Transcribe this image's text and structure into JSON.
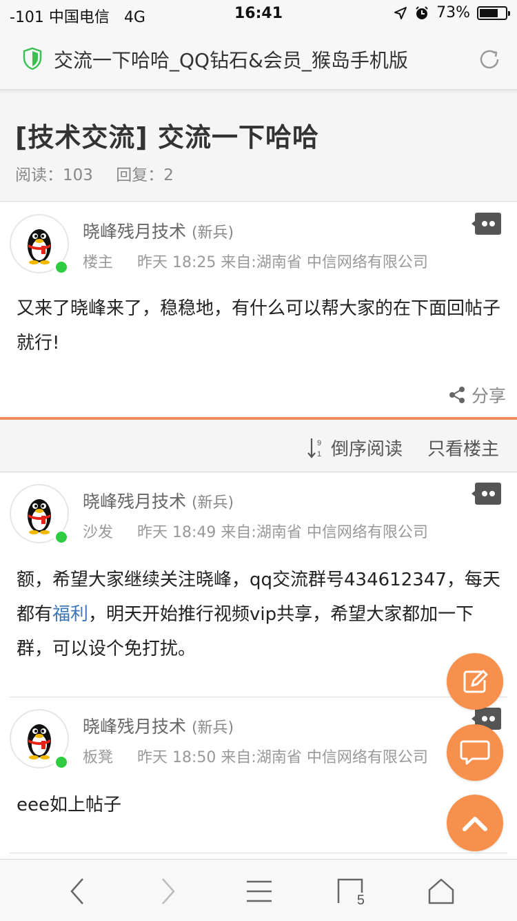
{
  "status_bar": {
    "carrier": "-101 中国电信",
    "network": "4G",
    "time": "16:41",
    "battery_text": "73%",
    "battery_level": 0.73
  },
  "browser": {
    "page_title": "交流一下哈哈_QQ钻石&会员_猴岛手机版",
    "tab_count": "5"
  },
  "thread": {
    "title": "[技术交流] 交流一下哈哈",
    "reads_label": "阅读：103",
    "replies_label": "回复：2"
  },
  "posts": [
    {
      "author": "晓峰残月技术",
      "rank": "(新兵)",
      "floor": "楼主",
      "time": "昨天 18:25",
      "location": "来自:湖南省 中信网络有限公司",
      "content": "又来了晓峰来了，稳稳地，有什么可以帮大家的在下面回帖子就行!"
    },
    {
      "author": "晓峰残月技术",
      "rank": "(新兵)",
      "floor": "沙发",
      "time": "昨天 18:49",
      "location": "来自:湖南省 中信网络有限公司",
      "content_before_link": "额，希望大家继续关注晓峰，qq交流群号434612347，每天都有",
      "link_text": "福利",
      "content_after_link": "，明天开始推行视频vip共享，希望大家都加一下群，可以设个免打扰。"
    },
    {
      "author": "晓峰残月技术",
      "rank": "(新兵)",
      "floor": "板凳",
      "time": "昨天 18:50",
      "location": "来自:湖南省 中信网络有限公司",
      "content": "eee如上帖子"
    }
  ],
  "actions": {
    "share": "分享",
    "reverse_order": "倒序阅读",
    "only_op": "只看楼主"
  },
  "colors": {
    "accent": "#f7904c",
    "link": "#3b77b8",
    "online": "#2ecc40"
  }
}
